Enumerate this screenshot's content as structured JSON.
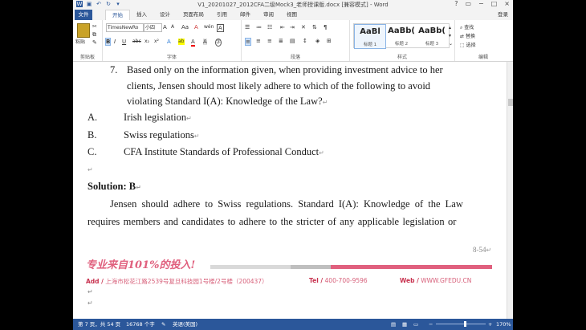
{
  "window": {
    "title": "V1_20201027_2012CFA二级Mock3_老师授课版.docx [兼容模式] - Word",
    "help_btn": "?",
    "min_btn": "−",
    "max_btn": "□",
    "close_btn": "×"
  },
  "tabs": {
    "file": "文件",
    "items": [
      "开始",
      "插入",
      "设计",
      "页面布局",
      "引用",
      "邮件",
      "审阅",
      "视图"
    ],
    "active": "开始",
    "login": "登录"
  },
  "ribbon": {
    "clipboard": {
      "paste_label": "粘贴",
      "group_label": "剪贴板"
    },
    "font": {
      "font_name": "TimesNewRo",
      "font_size": "小四",
      "group_label": "字体",
      "bold": "B",
      "italic": "I",
      "underline": "U",
      "strike": "abc",
      "sub": "x₂",
      "sup": "x²",
      "grow": "A",
      "shrink": "A",
      "case": "Aa",
      "clear": "A",
      "phonetic": "wén",
      "border": "A",
      "effects": "A",
      "highlight": "ab",
      "color": "A",
      "shade": "A",
      "enclose": "字"
    },
    "paragraph": {
      "group_label": "段落"
    },
    "styles": {
      "group_label": "样式",
      "items": [
        {
          "sample": "AaBl",
          "name": "标题 1"
        },
        {
          "sample": "AaBb(",
          "name": "标题 2"
        },
        {
          "sample": "AaBb(",
          "name": "标题 3"
        }
      ]
    },
    "editing": {
      "group_label": "编辑",
      "find": "查找",
      "replace": "替换",
      "select": "选择"
    }
  },
  "document": {
    "question_number": "7.",
    "question_lines": [
      "Based only on the information given, when providing investment advice to her",
      "clients, Jensen should most likely adhere to which of the following to avoid",
      "violating Standard I(A): Knowledge of the Law?"
    ],
    "options": [
      {
        "letter": "A.",
        "text": "Irish legislation"
      },
      {
        "letter": "B.",
        "text": "Swiss regulations"
      },
      {
        "letter": "C.",
        "text": "CFA Institute Standards of Professional Conduct"
      }
    ],
    "solution_heading": "Solution: B",
    "solution_lines": [
      "Jensen should adhere to Swiss regulations. Standard I(A): Knowledge of the Law",
      "requires members and candidates to adhere to the stricter of any applicable legislation or"
    ],
    "page_ref": "8-54",
    "para_mark": "↵"
  },
  "footer": {
    "slogan": "专业来自101%的投入!",
    "add_label": "Add /",
    "address": "上海市松花江路2539号复旦科技园1号楼/2号楼（200437）",
    "tel_label": "Tel /",
    "tel": "400-700-9596",
    "web_label": "Web /",
    "web": "WWW.GFEDU.CN"
  },
  "status": {
    "page": "第 7 页，共 54 页",
    "words": "16768 个字",
    "lang": "英语(美国)",
    "zoom": "170%"
  }
}
